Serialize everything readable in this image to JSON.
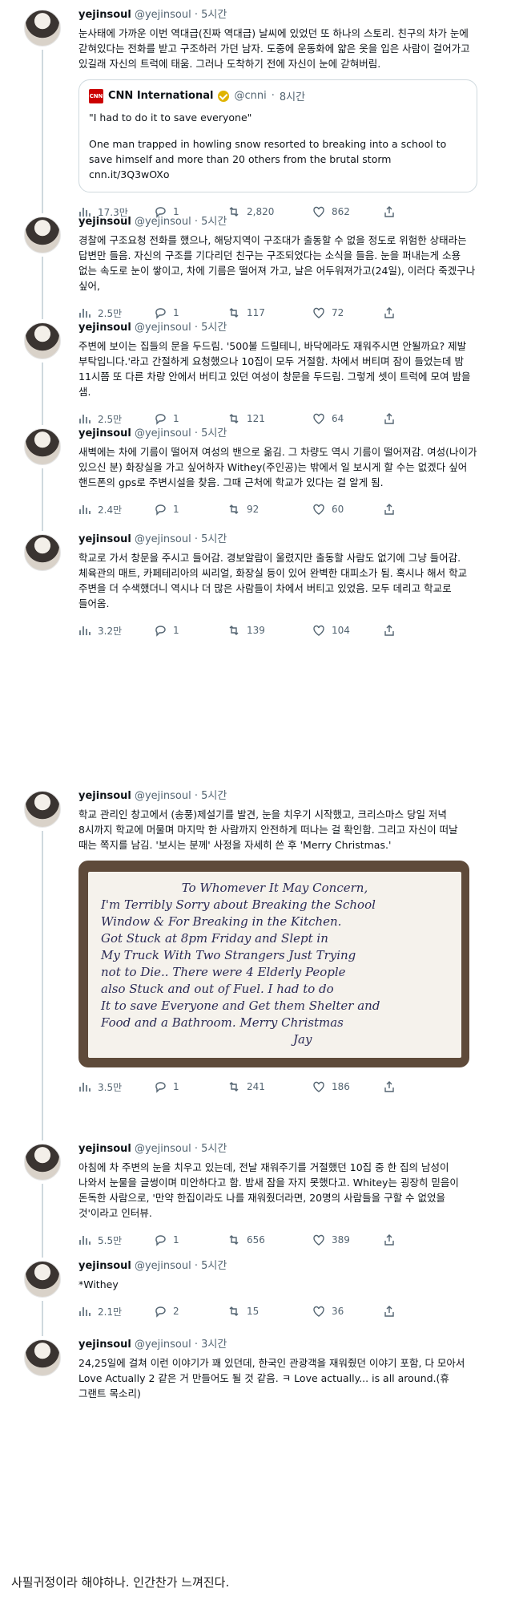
{
  "tweets": [
    {
      "name": "yejinsoul",
      "handle": "@yejinsoul",
      "dot": "·",
      "time": "5시간",
      "text": "눈사태에 가까운 이번 역대급(진짜 역대급) 날씨에 있었던 또 하나의 스토리. 친구의 차가 눈에 갇혀있다는 전화를 받고 구조하러 가던 남자. 도중에 운동화에 얇은 옷을 입은 사람이 걸어가고 있길래 자신의 트럭에 태움. 그러나 도착하기 전에 자신이 눈에 갇혀버림.",
      "quote": {
        "source": "CNN International",
        "handle": "@cnni",
        "dot": "·",
        "time": "8시간",
        "headline": "\"I had to do it to save everyone\"",
        "body": "One man trapped in howling snow resorted to breaking into a school to save himself and more than 20 others from the brutal storm",
        "link": "cnn.it/3Q3wOXo"
      },
      "views": "17.3만",
      "replies": "1",
      "retweets": "2,820",
      "likes": "862"
    },
    {
      "name": "yejinsoul",
      "handle": "@yejinsoul",
      "dot": "·",
      "time": "5시간",
      "text": "경찰에 구조요청 전화를 했으나, 해당지역이 구조대가 출동할 수 없을 정도로 위험한 상태라는 답변만 들음. 자신의 구조를 기다리던 친구는 구조되었다는 소식을 들음. 눈을 퍼내는게 소용 없는 속도로 눈이 쌓이고, 차에 기름은 떨어져 가고, 날은 어두워져가고(24일), 이러다 죽겠구나 싶어,",
      "views": "2.5만",
      "replies": "1",
      "retweets": "117",
      "likes": "72"
    },
    {
      "name": "yejinsoul",
      "handle": "@yejinsoul",
      "dot": "·",
      "time": "5시간",
      "text": "주변에 보이는 집들의 문을 두드림. '500불 드릴테니, 바닥에라도 재워주시면 안될까요? 제발 부탁입니다.'라고 간절하게 요청했으나 10집이 모두 거절함. 차에서 버티며 잠이 들었는데 밤 11시쯤 또 다른 차량 안에서 버티고 있던 여성이 창문을 두드림. 그렇게 셋이 트럭에 모여 밤을 샘.",
      "views": "2.5만",
      "replies": "1",
      "retweets": "121",
      "likes": "64"
    },
    {
      "name": "yejinsoul",
      "handle": "@yejinsoul",
      "dot": "·",
      "time": "5시간",
      "text": "새벽에는 차에 기름이 떨어져 여성의 밴으로 옮김. 그 차량도 역시 기름이 떨어져감. 여성(나이가 있으신 분) 화장실을 가고 싶어하자 Withey(주인공)는 밖에서 일 보시게 할 수는 없겠다 싶어 핸드폰의 gps로 주변시설을 찾음. 그때 근처에 학교가 있다는 걸 알게 됨.",
      "views": "2.4만",
      "replies": "1",
      "retweets": "92",
      "likes": "60"
    },
    {
      "name": "yejinsoul",
      "handle": "@yejinsoul",
      "dot": "·",
      "time": "5시간",
      "text": "학교로 가서 창문을 주시고 들어감. 경보알람이 울렸지만 출동할 사람도 없기에 그냥 들어감. 체육관의 매트, 카페테리아의 씨리얼, 화장실 등이 있어 완벽한 대피소가 됨. 혹시나 해서 학교 주변을 더 수색했더니 역시나 더 많은 사람들이 차에서 버티고 있었음. 모두 데리고 학교로 들어옴.",
      "views": "3.2만",
      "replies": "1",
      "retweets": "139",
      "likes": "104"
    },
    {
      "name": "yejinsoul",
      "handle": "@yejinsoul",
      "dot": "·",
      "time": "5시간",
      "text": "학교 관리인 창고에서 (송풍)제설기를 발견, 눈을 치우기 시작했고, 크리스마스 당일 저녁 8시까지 학교에 머물며 마지막 한 사람까지 안전하게 떠나는 걸 확인함. 그리고 자신이 떠날 때는 쪽지를 남김. '보시는 분께' 사정을 자세히 쓴 후 'Merry Christmas.'",
      "note": [
        "To Whomever It May Concern,",
        "I'm Terribly Sorry about Breaking the School",
        "Window & For Breaking in the Kitchen.",
        "Got Stuck at 8pm Friday and Slept in",
        "My Truck With Two Strangers Just Trying",
        "not to Die.. There were 4 Elderly People",
        "also Stuck and out of Fuel. I had to do",
        "It to save Everyone and Get them Shelter and",
        "Food and a Bathroom. Merry Christmas",
        "Jay"
      ],
      "views": "3.5만",
      "replies": "1",
      "retweets": "241",
      "likes": "186"
    },
    {
      "name": "yejinsoul",
      "handle": "@yejinsoul",
      "dot": "·",
      "time": "5시간",
      "text": "아침에 차 주변의 눈을 치우고 있는데, 전날 재워주기를 거절했던 10집 중 한 집의 남성이 나와서 눈물을 글썽이며 미안하다고 함. 밤새 잠을 자지 못했다고. Whitey는 굉장히 믿음이 돈독한 사람으로, '만약 한집이라도 나를 재워줬더라면, 20명의 사람들을 구할 수 없었을 것'이라고 인터뷰.",
      "views": "5.5만",
      "replies": "1",
      "retweets": "656",
      "likes": "389"
    },
    {
      "name": "yejinsoul",
      "handle": "@yejinsoul",
      "dot": "·",
      "time": "5시간",
      "text": "*Withey",
      "views": "2.1만",
      "replies": "2",
      "retweets": "15",
      "likes": "36"
    },
    {
      "name": "yejinsoul",
      "handle": "@yejinsoul",
      "dot": "·",
      "time": "3시간",
      "text": "24,25일에 걸쳐 이런 이야기가 꽤 있던데, 한국인 관광객을 재워줬던 이야기 포함, 다 모아서 Love Actually 2 같은 거 만들어도 될 것 같음. ㅋ Love actually... is all around.(휴 그랜트 목소리)"
    }
  ],
  "caption": "사필귀정이라 해야하나. 인간찬가 느껴진다.",
  "colors": {
    "text": "#0f1419",
    "muted": "#536471",
    "line": "#cfd9de",
    "cnn": "#cc0000"
  }
}
